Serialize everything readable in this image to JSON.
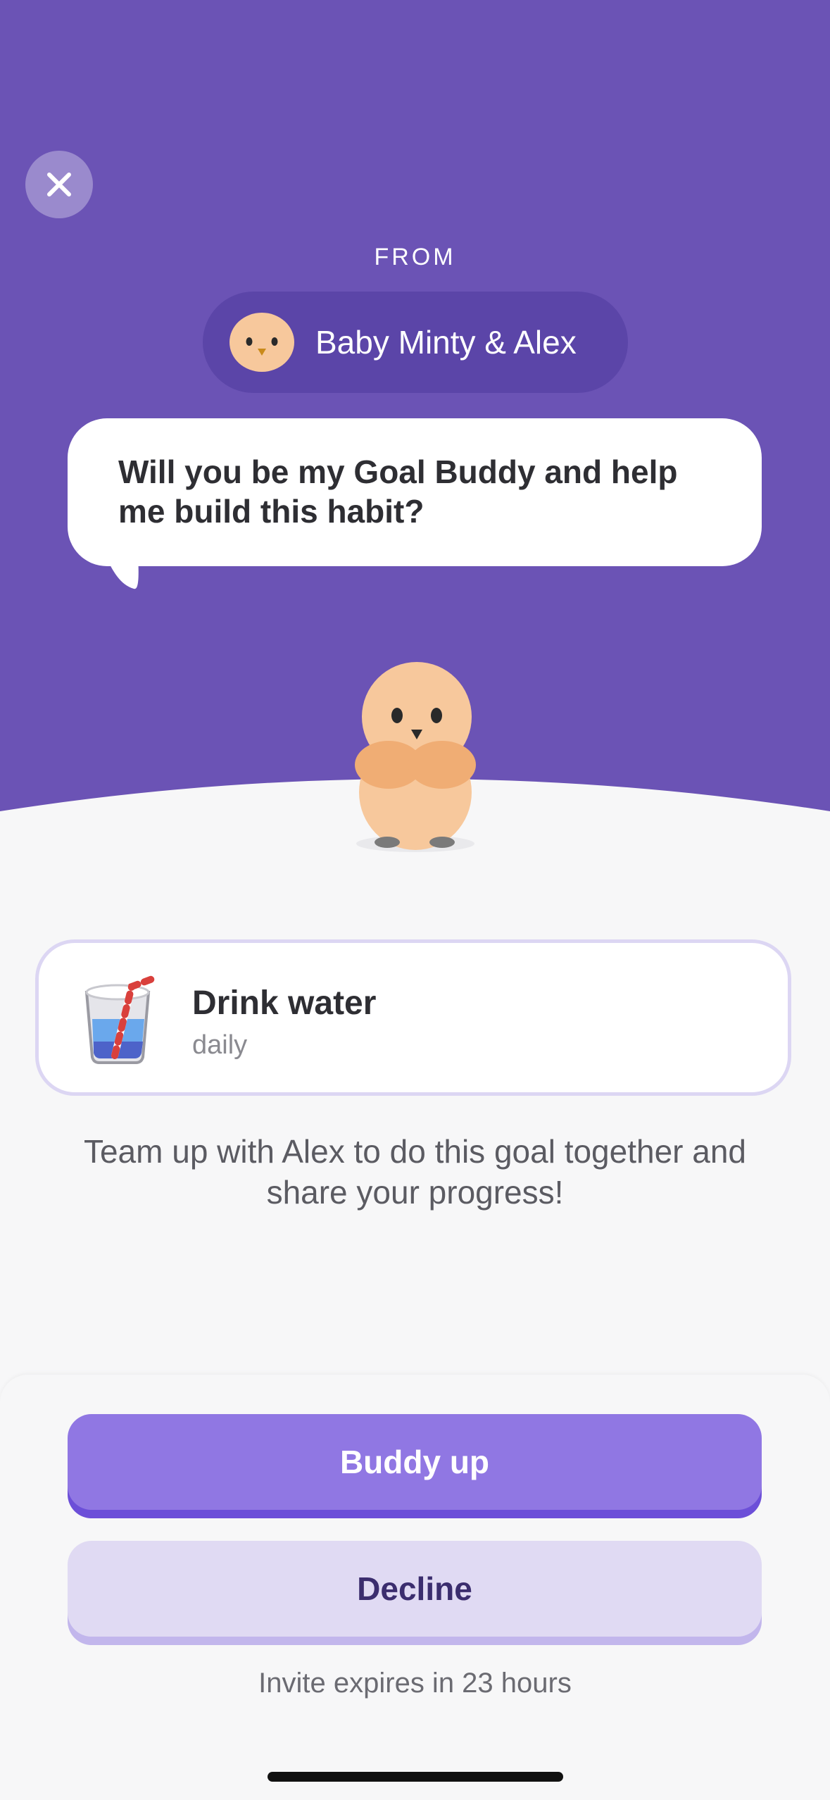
{
  "colors": {
    "hero_bg": "#6b53b5",
    "sender_pill": "#5b45a8",
    "primary": "#9077e3",
    "secondary": "#e0daf3",
    "page_bg": "#f7f7f8"
  },
  "header": {
    "close_icon": "close-icon",
    "from_label": "FROM",
    "sender_name": "Baby Minty & Alex"
  },
  "bubble": {
    "text": "Will you be my Goal Buddy and help me build this habit?"
  },
  "goal": {
    "icon": "water-glass-icon",
    "title": "Drink water",
    "frequency": "daily"
  },
  "description": "Team up with Alex to do this goal together and share your progress!",
  "actions": {
    "primary_label": "Buddy up",
    "secondary_label": "Decline"
  },
  "expires": "Invite expires in 23 hours"
}
